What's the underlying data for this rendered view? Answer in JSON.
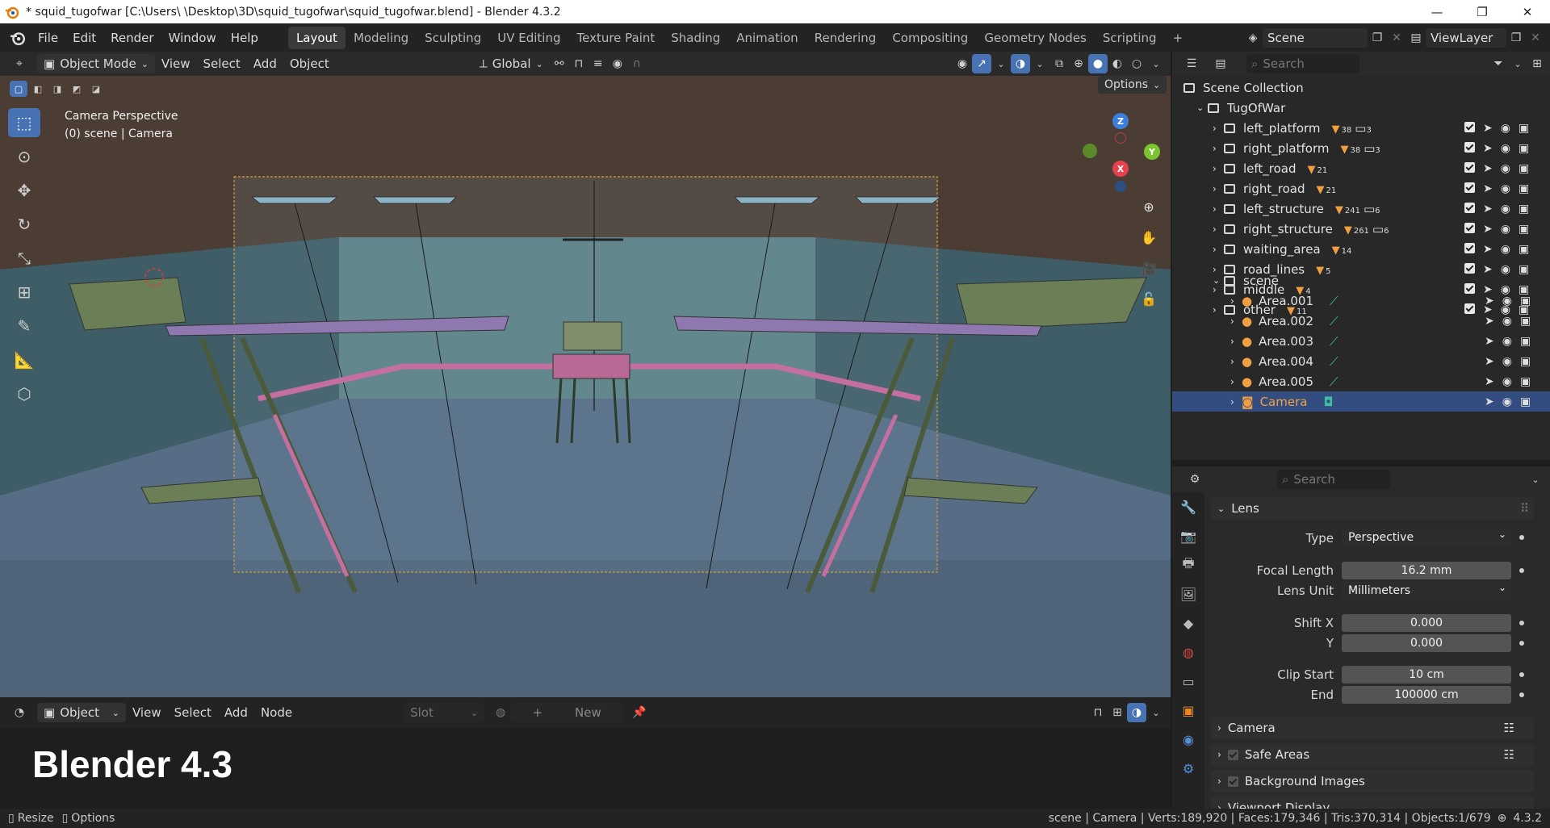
{
  "window": {
    "title": "* squid_tugofwar [C:\\Users\\        \\Desktop\\3D\\squid_tugofwar\\squid_tugofwar.blend] - Blender 4.3.2",
    "minimize": "—",
    "maximize": "❐",
    "close": "✕"
  },
  "menu": {
    "items": [
      "File",
      "Edit",
      "Render",
      "Window",
      "Help"
    ]
  },
  "workspaces": {
    "tabs": [
      "Layout",
      "Modeling",
      "Sculpting",
      "UV Editing",
      "Texture Paint",
      "Shading",
      "Animation",
      "Rendering",
      "Compositing",
      "Geometry Nodes",
      "Scripting"
    ],
    "active": "Layout",
    "add": "+"
  },
  "scene_selector": {
    "scene": "Scene",
    "view_layer": "ViewLayer"
  },
  "viewport_header": {
    "mode": "Object Mode",
    "menus": [
      "View",
      "Select",
      "Add",
      "Object"
    ],
    "transform_orientation": "Global",
    "options": "Options"
  },
  "viewport": {
    "camera_label": "Camera Perspective",
    "object_label": "(0) scene | Camera",
    "gizmo": {
      "z": "Z",
      "y": "Y",
      "x": "X"
    }
  },
  "shader_header": {
    "mode": "Object",
    "menus": [
      "View",
      "Select",
      "Add",
      "Node"
    ],
    "slot": "Slot",
    "new_button": "New"
  },
  "overlay_label": "Blender 4.3",
  "outliner": {
    "search_placeholder": "Search",
    "root": "Scene Collection",
    "collection": "TugOfWar",
    "items": [
      {
        "name": "left_platform",
        "count": "38",
        "sub": "3"
      },
      {
        "name": "right_platform",
        "count": "38",
        "sub": "3"
      },
      {
        "name": "left_road",
        "count": "21",
        "sub": ""
      },
      {
        "name": "right_road",
        "count": "21",
        "sub": ""
      },
      {
        "name": "left_structure",
        "count": "241",
        "sub": "6"
      },
      {
        "name": "right_structure",
        "count": "261",
        "sub": "6"
      },
      {
        "name": "waiting_area",
        "count": "14",
        "sub": ""
      },
      {
        "name": "road_lines",
        "count": "5",
        "sub": ""
      },
      {
        "name": "middle",
        "count": "4",
        "sub": ""
      },
      {
        "name": "other",
        "count": "11",
        "sub": ""
      }
    ],
    "scene_collection": "scene",
    "scene_items": [
      "Area.001",
      "Area.002",
      "Area.003",
      "Area.004",
      "Area.005",
      "Camera"
    ],
    "selected": "Camera"
  },
  "properties": {
    "search_placeholder": "Search",
    "lens_panel": "Lens",
    "type_label": "Type",
    "type_value": "Perspective",
    "focal_label": "Focal Length",
    "focal_value": "16.2 mm",
    "lens_unit_label": "Lens Unit",
    "lens_unit_value": "Millimeters",
    "shift_x_label": "Shift X",
    "shift_x_value": "0.000",
    "shift_y_label": "Y",
    "shift_y_value": "0.000",
    "clip_start_label": "Clip Start",
    "clip_start_value": "10 cm",
    "clip_end_label": "End",
    "clip_end_value": "100000 cm",
    "panels": [
      "Camera",
      "Safe Areas",
      "Background Images",
      "Viewport Display"
    ]
  },
  "status": {
    "left": [
      "Resize",
      "Options"
    ],
    "right": "scene | Camera | Verts:189,920 | Faces:179,346 | Tris:370,314 | Objects:1/679",
    "version": "4.3.2"
  },
  "colors": {
    "accent": "#4772b3",
    "selected_row": "#334d80",
    "camera_orange": "#f0a040",
    "gizmo_x": "#e8404f",
    "gizmo_y": "#7cc430",
    "gizmo_z": "#3c7fdb"
  }
}
